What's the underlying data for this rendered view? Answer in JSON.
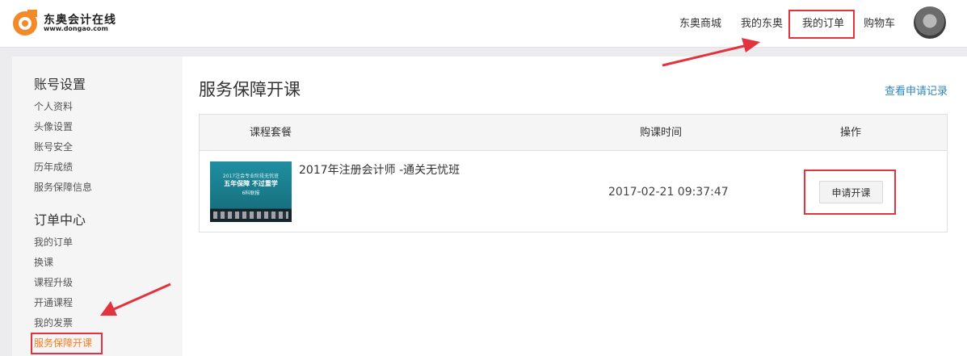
{
  "header": {
    "logo_name": "东奥会计在线",
    "logo_url": "www.dongao.com",
    "nav": [
      {
        "label": "东奥商城"
      },
      {
        "label": "我的东奥"
      },
      {
        "label": "我的订单"
      },
      {
        "label": "购物车"
      }
    ]
  },
  "sidebar": {
    "sections": [
      {
        "title": "账号设置",
        "items": [
          "个人资料",
          "头像设置",
          "账号安全",
          "历年成绩",
          "服务保障信息"
        ]
      },
      {
        "title": "订单中心",
        "items": [
          "我的订单",
          "换课",
          "课程升级",
          "开通课程",
          "我的发票",
          "服务保障开课"
        ]
      }
    ],
    "active_item": "服务保障开课"
  },
  "main": {
    "title": "服务保障开课",
    "records_link": "查看申请记录",
    "table": {
      "columns": [
        "课程套餐",
        "购课时间",
        "操作"
      ],
      "rows": [
        {
          "thumbnail": {
            "line1": "2017注会专业阶段无忧班",
            "line2": "五年保障 不过重学",
            "line3": "6科联报"
          },
          "course": "2017年注册会计师 -通关无忧班",
          "purchase_time": "2017-02-21 09:37:47",
          "action": "申请开课"
        }
      ]
    }
  },
  "colors": {
    "accent_orange": "#f57d22",
    "link_blue": "#2e86c1",
    "annotation_red": "#e2333e"
  }
}
